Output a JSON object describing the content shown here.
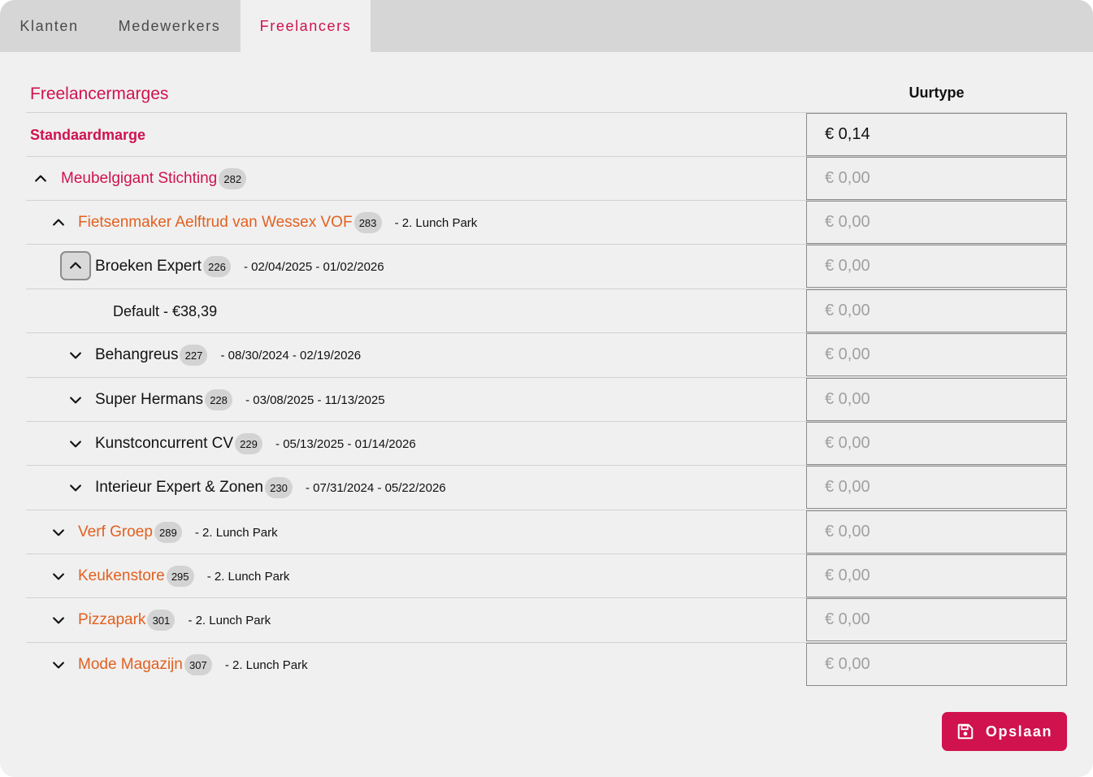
{
  "tabs": [
    {
      "label": "Klanten"
    },
    {
      "label": "Medewerkers"
    },
    {
      "label": "Freelancers"
    }
  ],
  "section_title": "Freelancermarges",
  "column_header": "Uurtype",
  "standard": {
    "label": "Standaardmarge",
    "value": "€ 0,14"
  },
  "rows": [
    {
      "name": "Meubelgigant Stichting",
      "badge": "282",
      "sub": "",
      "value": "€ 0,00"
    },
    {
      "name": "Fietsenmaker Aelftrud van Wessex VOF",
      "badge": "283",
      "sub": "- 2. Lunch Park",
      "value": "€ 0,00"
    },
    {
      "name": "Broeken Expert",
      "badge": "226",
      "sub": "- 02/04/2025 - 01/02/2026",
      "value": "€ 0,00"
    },
    {
      "name": "Default - €38,39",
      "badge": "",
      "sub": "",
      "value": "€ 0,00"
    },
    {
      "name": "Behangreus",
      "badge": "227",
      "sub": "- 08/30/2024 - 02/19/2026",
      "value": "€ 0,00"
    },
    {
      "name": "Super Hermans",
      "badge": "228",
      "sub": "- 03/08/2025 - 11/13/2025",
      "value": "€ 0,00"
    },
    {
      "name": "Kunstconcurrent CV",
      "badge": "229",
      "sub": "- 05/13/2025 - 01/14/2026",
      "value": "€ 0,00"
    },
    {
      "name": "Interieur Expert & Zonen",
      "badge": "230",
      "sub": "- 07/31/2024 - 05/22/2026",
      "value": "€ 0,00"
    },
    {
      "name": "Verf Groep",
      "badge": "289",
      "sub": "- 2. Lunch Park",
      "value": "€ 0,00"
    },
    {
      "name": "Keukenstore",
      "badge": "295",
      "sub": "- 2. Lunch Park",
      "value": "€ 0,00"
    },
    {
      "name": "Pizzapark",
      "badge": "301",
      "sub": "- 2. Lunch Park",
      "value": "€ 0,00"
    },
    {
      "name": "Mode Magazijn",
      "badge": "307",
      "sub": "- 2. Lunch Park",
      "value": "€ 0,00"
    }
  ],
  "save_label": "Opslaan",
  "colors": {
    "accent": "#d0124f",
    "orange": "#e2601f",
    "tabbar": "#d6d6d6",
    "background": "#f0f0f0"
  }
}
